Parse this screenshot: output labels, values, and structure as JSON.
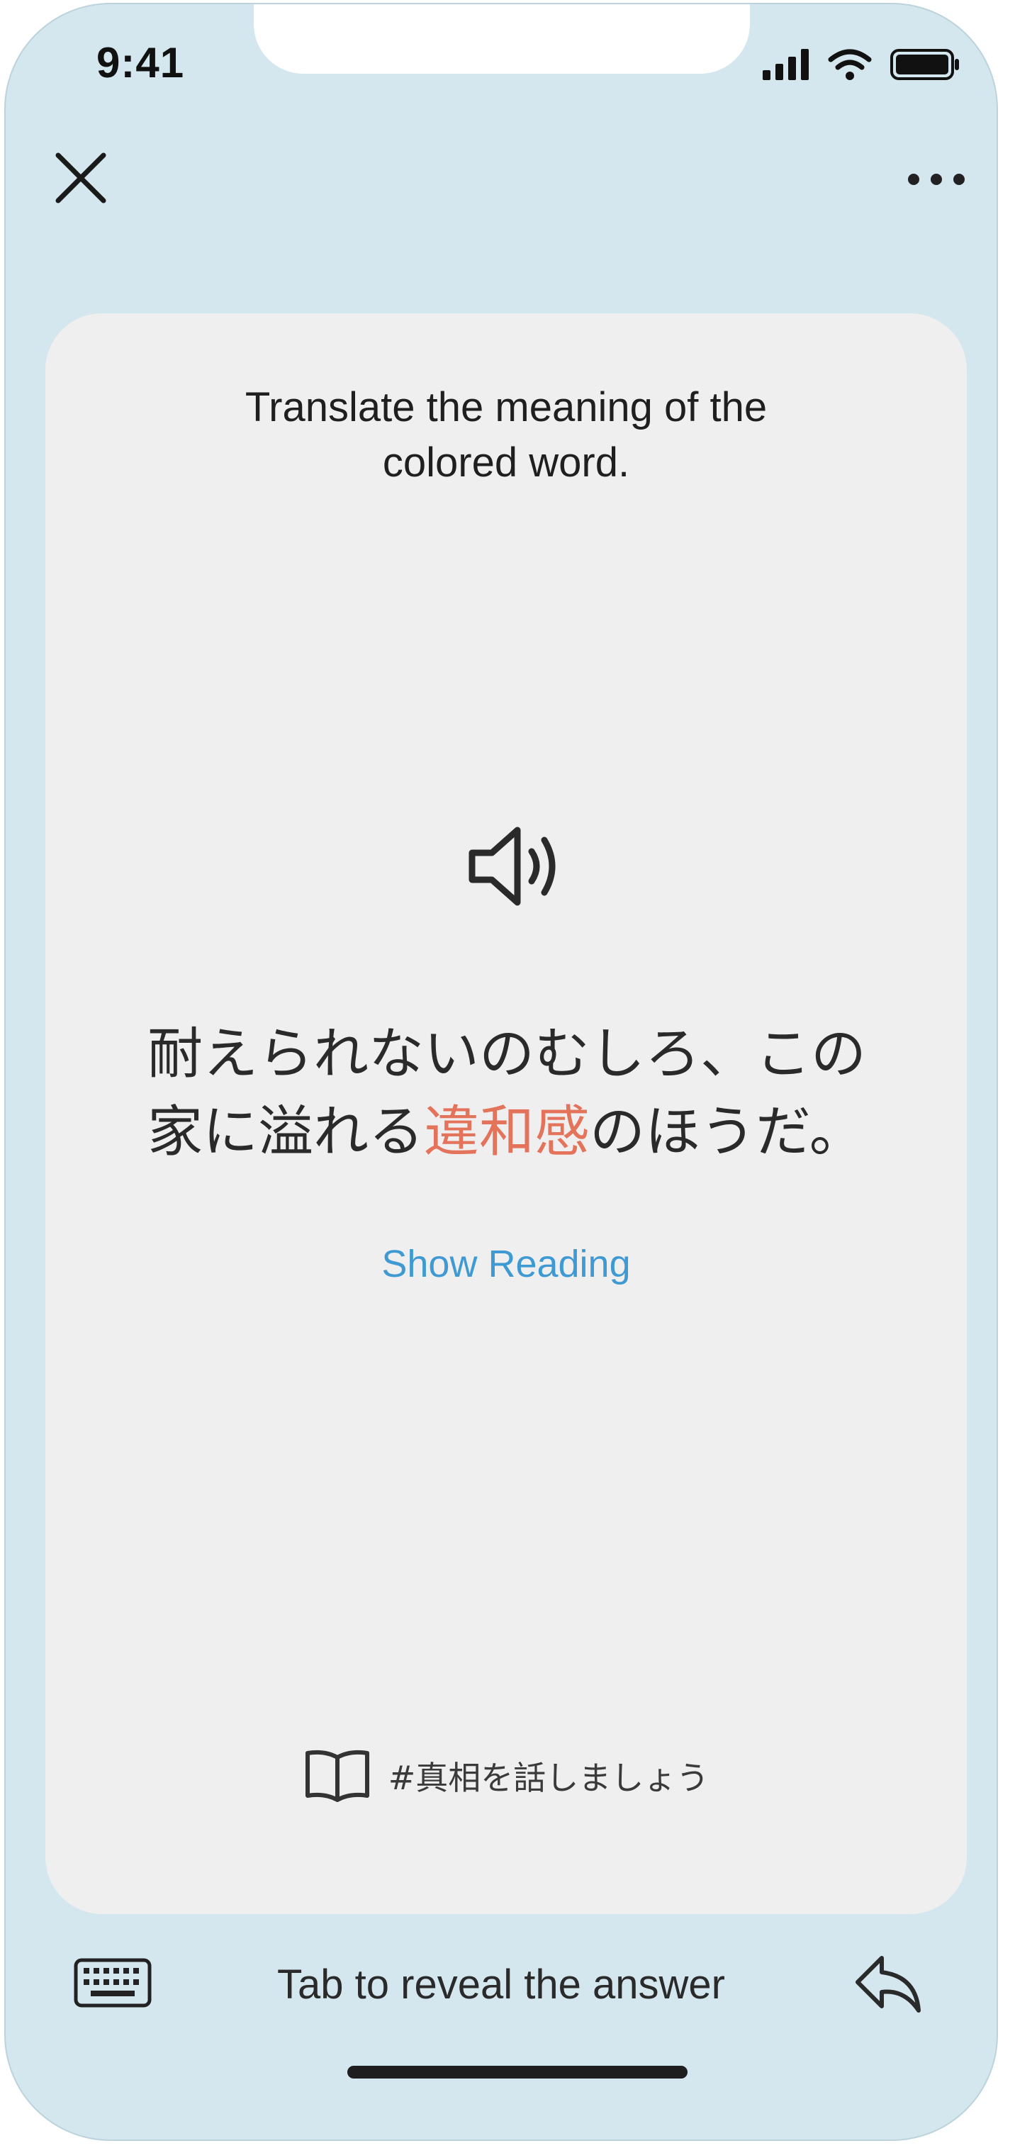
{
  "status_bar": {
    "time": "9:41"
  },
  "header": {
    "close_icon": "close-icon",
    "more_icon": "more-horizontal-icon"
  },
  "card": {
    "instruction": "Translate the meaning of the colored word.",
    "speaker_icon": "speaker-icon",
    "sentence": {
      "line1": "耐えられないのむしろ、この",
      "line2_before": "家に溢れる",
      "highlight": "違和感",
      "line2_after": "のほうだ。"
    },
    "show_reading": "Show Reading",
    "tag": "#真相を話しましょう",
    "tag_icon": "book-icon"
  },
  "bottom_bar": {
    "reveal_text": "Tab to reveal the answer",
    "keyboard_icon": "keyboard-icon",
    "undo_icon": "undo-icon"
  },
  "colors": {
    "background": "#d5e7ee",
    "card": "#f0efef",
    "highlight": "#e4735b",
    "link": "#3f9ad3"
  }
}
